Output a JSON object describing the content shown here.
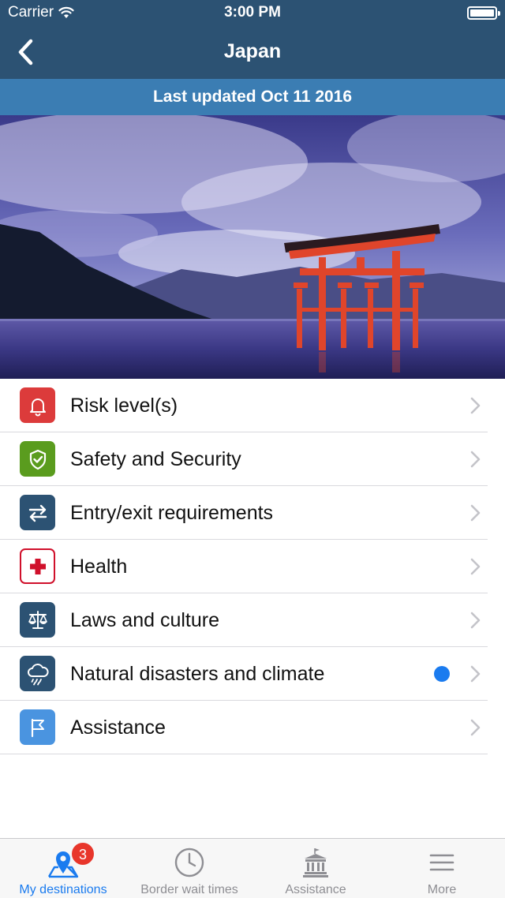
{
  "status_bar": {
    "carrier": "Carrier",
    "time": "3:00 PM"
  },
  "nav": {
    "title": "Japan",
    "back_icon": "chevron-left-icon"
  },
  "updated_label": "Last updated Oct 11 2016",
  "hero_image": "torii-gate-on-water-photo",
  "menu": [
    {
      "label": "Risk level(s)",
      "icon": "bell-icon",
      "color": "#dc3b3b",
      "new": false
    },
    {
      "label": "Safety and Security",
      "icon": "shield-check-icon",
      "color": "#5a9c1e",
      "new": false
    },
    {
      "label": "Entry/exit requirements",
      "icon": "swap-arrows-icon",
      "color": "#2c5273",
      "new": false
    },
    {
      "label": "Health",
      "icon": "red-cross-icon",
      "color": "#d0102b",
      "new": false
    },
    {
      "label": "Laws and culture",
      "icon": "scales-icon",
      "color": "#2c5273",
      "new": false
    },
    {
      "label": "Natural disasters and climate",
      "icon": "rain-cloud-icon",
      "color": "#2c5273",
      "new": true
    },
    {
      "label": "Assistance",
      "icon": "flag-icon",
      "color": "#4a94e0",
      "new": false
    }
  ],
  "tabs": [
    {
      "label": "My destinations",
      "icon": "map-pin-icon",
      "badge": "3",
      "active": true
    },
    {
      "label": "Border wait times",
      "icon": "clock-icon",
      "active": false
    },
    {
      "label": "Assistance",
      "icon": "embassy-building-icon",
      "active": false
    },
    {
      "label": "More",
      "icon": "hamburger-menu-icon",
      "active": false
    }
  ],
  "colors": {
    "header": "#2c5273",
    "updated_bar": "#3b7db3",
    "accent": "#1a7bef",
    "badge": "#e8362b"
  }
}
